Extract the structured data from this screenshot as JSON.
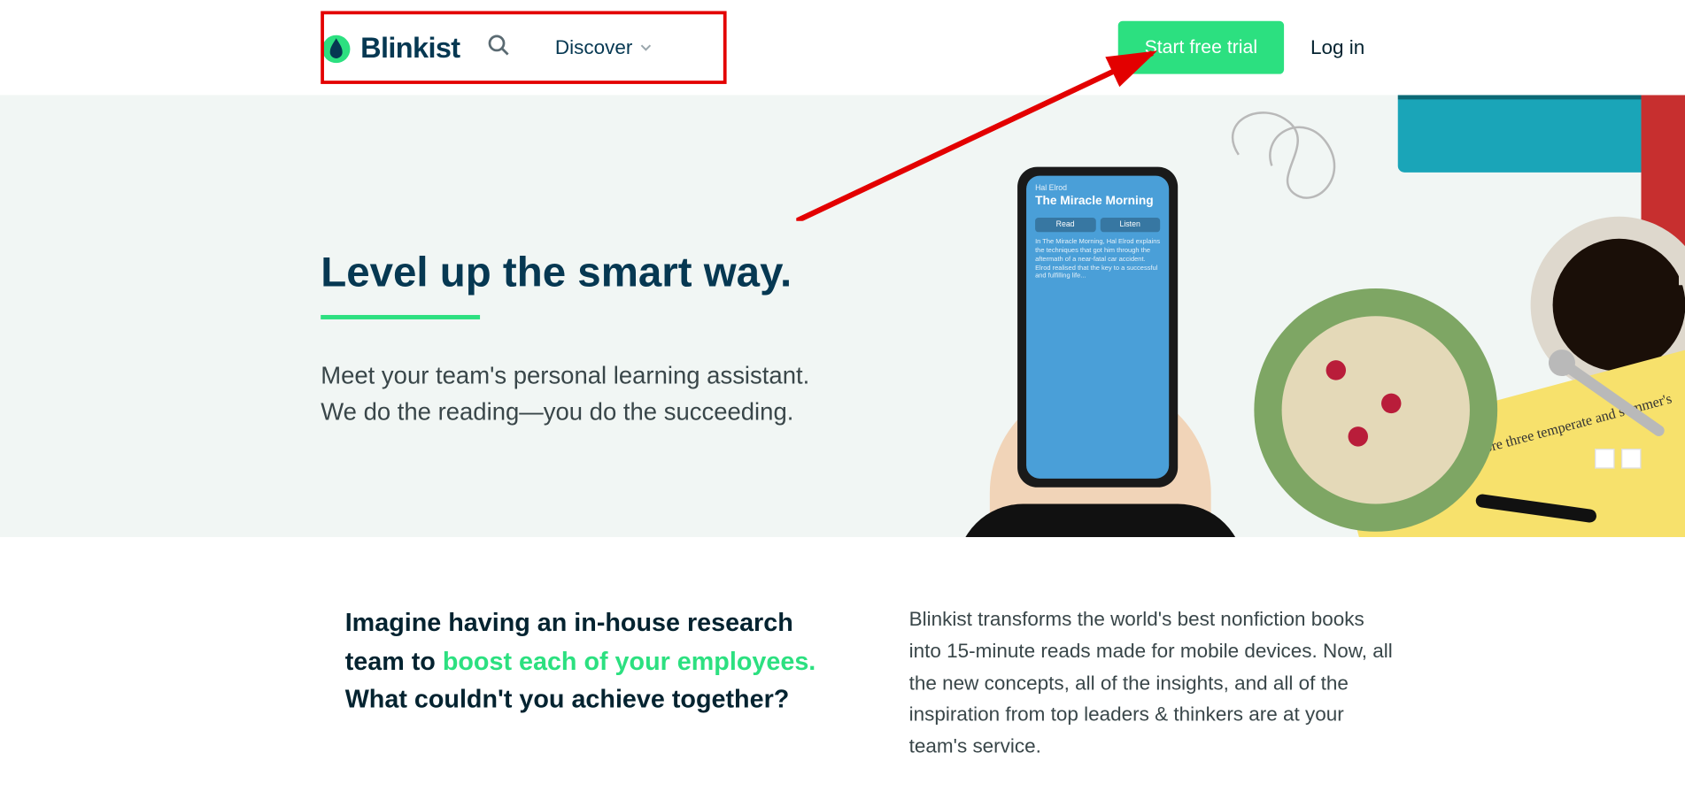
{
  "header": {
    "brand": "Blinkist",
    "discover_label": "Discover",
    "trial_label": "Start free trial",
    "login_label": "Log in"
  },
  "hero": {
    "title": "Level up the smart way.",
    "subtitle": "Meet your team's personal learning assistant. We do the reading—you do the succeeding.",
    "phone": {
      "author": "Hal Elrod",
      "title": "The Miracle Morning",
      "read_label": "Read",
      "listen_label": "Listen"
    }
  },
  "section2": {
    "left_part1": "Imagine having an in-house research team to ",
    "left_highlight": "boost each of your employees.",
    "left_part2": " What couldn't you achieve together?",
    "right": "Blinkist transforms the world's best nonfiction books into 15-minute reads made for mobile devices. Now, all the new concepts, all of the insights, and all of the inspiration from top leaders & thinkers are at your team's service."
  }
}
